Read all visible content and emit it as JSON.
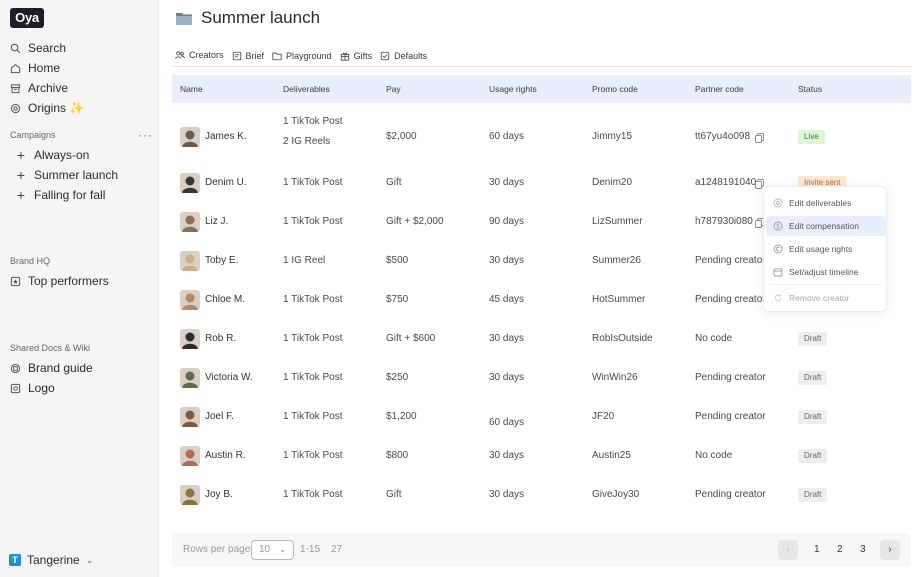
{
  "sidebar": {
    "logo": "Oya",
    "nav": [
      {
        "label": "Search",
        "icon": "search-icon"
      },
      {
        "label": "Home",
        "icon": "home-icon"
      },
      {
        "label": "Archive",
        "icon": "archive-icon"
      },
      {
        "label": "Origins ✨",
        "icon": "origins-icon"
      }
    ],
    "campaigns_label": "Campaigns",
    "campaigns_more": "···",
    "campaigns": [
      {
        "label": "Always-on"
      },
      {
        "label": "Summer launch"
      },
      {
        "label": "Falling for fall"
      }
    ],
    "brand_hq_label": "Brand HQ",
    "brand_hq": [
      {
        "label": "Top performers",
        "icon": "star-box-icon"
      }
    ],
    "shared_label": "Shared Docs & Wiki",
    "shared": [
      {
        "label": "Brand guide",
        "icon": "book-icon"
      },
      {
        "label": "Logo",
        "icon": "image-icon"
      }
    ],
    "workspace": {
      "initial": "T",
      "name": "Tangerine"
    }
  },
  "page": {
    "title": "Summer launch",
    "tabs": [
      {
        "label": "Creators",
        "icon": "creators-icon",
        "active": true
      },
      {
        "label": "Brief",
        "icon": "brief-icon"
      },
      {
        "label": "Playground",
        "icon": "folder-icon"
      },
      {
        "label": "Gifts",
        "icon": "gift-icon"
      },
      {
        "label": "Defaults",
        "icon": "check-box-icon"
      }
    ]
  },
  "table": {
    "columns": [
      "Name",
      "Deliverables",
      "Pay",
      "Usage rights",
      "Promo code",
      "Partner code",
      "Status"
    ],
    "rows": [
      {
        "name": "James K.",
        "deliverables": [
          "1 TikTok Post",
          "2 IG Reels"
        ],
        "pay": "$2,000",
        "usage": "60 days",
        "promo": "Jimmy15",
        "partner": "tt67yu4o098",
        "partner_copy": true,
        "status": "Live",
        "status_type": "live",
        "avatar_color": "#6b5a4e"
      },
      {
        "name": "Denim U.",
        "deliverables": [
          "1 TikTok Post"
        ],
        "pay": "Gift",
        "usage": "30 days",
        "promo": "Denim20",
        "partner": "a1248191040",
        "partner_copy": true,
        "status": "Invite sent",
        "status_type": "invite",
        "avatar_color": "#3a3634"
      },
      {
        "name": "Liz J.",
        "deliverables": [
          "1 TikTok Post"
        ],
        "pay": "Gift + $2,000",
        "usage": "90 days",
        "promo": "LizSummer",
        "partner": "h787930i080",
        "partner_copy": true,
        "status": "",
        "status_type": "",
        "avatar_color": "#8a6a5a"
      },
      {
        "name": "Toby E.",
        "deliverables": [
          "1 IG Reel"
        ],
        "pay": "$500",
        "usage": "30 days",
        "promo": "Summer26",
        "partner": "Pending creator",
        "partner_copy": false,
        "status": "",
        "status_type": "",
        "avatar_color": "#c9b08c"
      },
      {
        "name": "Chloe M.",
        "deliverables": [
          "1 TikTok Post"
        ],
        "pay": "$750",
        "usage": "45 days",
        "promo": "HotSummer",
        "partner": "Pending creator",
        "partner_copy": false,
        "status": "",
        "status_type": "",
        "avatar_color": "#b58a63"
      },
      {
        "name": "Rob R.",
        "deliverables": [
          "1 TikTok Post"
        ],
        "pay": "Gift + $600",
        "usage": "30 days",
        "promo": "RobIsOutside",
        "partner": "No code",
        "partner_copy": false,
        "status": "Draft",
        "status_type": "draft",
        "avatar_color": "#2f2a2a"
      },
      {
        "name": "Victoria W.",
        "deliverables": [
          "1 TikTok Post"
        ],
        "pay": "$250",
        "usage": "30 days",
        "promo": "WinWin26",
        "partner": "Pending creator",
        "partner_copy": false,
        "status": "Draft",
        "status_type": "draft",
        "avatar_color": "#5f6b4a"
      },
      {
        "name": "Joel F.",
        "deliverables": [
          "1 TikTok Post"
        ],
        "pay": "$1,200",
        "usage": "60 days",
        "promo": "JF20",
        "partner": "Pending creator",
        "partner_copy": false,
        "status": "Draft",
        "status_type": "draft",
        "avatar_color": "#7c5a44"
      },
      {
        "name": "Austin R.",
        "deliverables": [
          "1 TikTok Post"
        ],
        "pay": "$800",
        "usage": "30 days",
        "promo": "Austin25",
        "partner": "No code",
        "partner_copy": false,
        "status": "Draft",
        "status_type": "draft",
        "avatar_color": "#b06a5a"
      },
      {
        "name": "Joy B.",
        "deliverables": [
          "1 TikTok Post"
        ],
        "pay": "Gift",
        "usage": "30 days",
        "promo": "GiveJoy30",
        "partner": "Pending creator",
        "partner_copy": false,
        "status": "Draft",
        "status_type": "draft",
        "avatar_color": "#8a7440"
      }
    ]
  },
  "menu": {
    "items": [
      {
        "label": "Edit deliverables",
        "icon": "deliverables-icon",
        "state": "normal"
      },
      {
        "label": "Edit compensation",
        "icon": "dollar-icon",
        "state": "highlight"
      },
      {
        "label": "Edit usage rights",
        "icon": "copyright-icon",
        "state": "normal"
      },
      {
        "label": "Set/adjust timeline",
        "icon": "calendar-icon",
        "state": "normal"
      },
      {
        "label": "Remove creator",
        "icon": "refresh-icon",
        "state": "disabled"
      }
    ]
  },
  "footer": {
    "rows_per_page_label": "Rows per page",
    "rows_per_page_value": "10",
    "range": "1-15",
    "total": "27",
    "pages": [
      "1",
      "2",
      "3"
    ],
    "prev_icon": "chevron-left-icon",
    "next_icon": "chevron-right-icon"
  },
  "colors": {
    "header_bg": "#e8eefa",
    "live_bg": "#dff4d8",
    "live_fg": "#2f8a2a",
    "invite_bg": "#fbe7d3",
    "invite_fg": "#c2662a",
    "draft_bg": "#eeeeee",
    "draft_fg": "#666666",
    "workspace_badge": "#1e8fd8"
  }
}
